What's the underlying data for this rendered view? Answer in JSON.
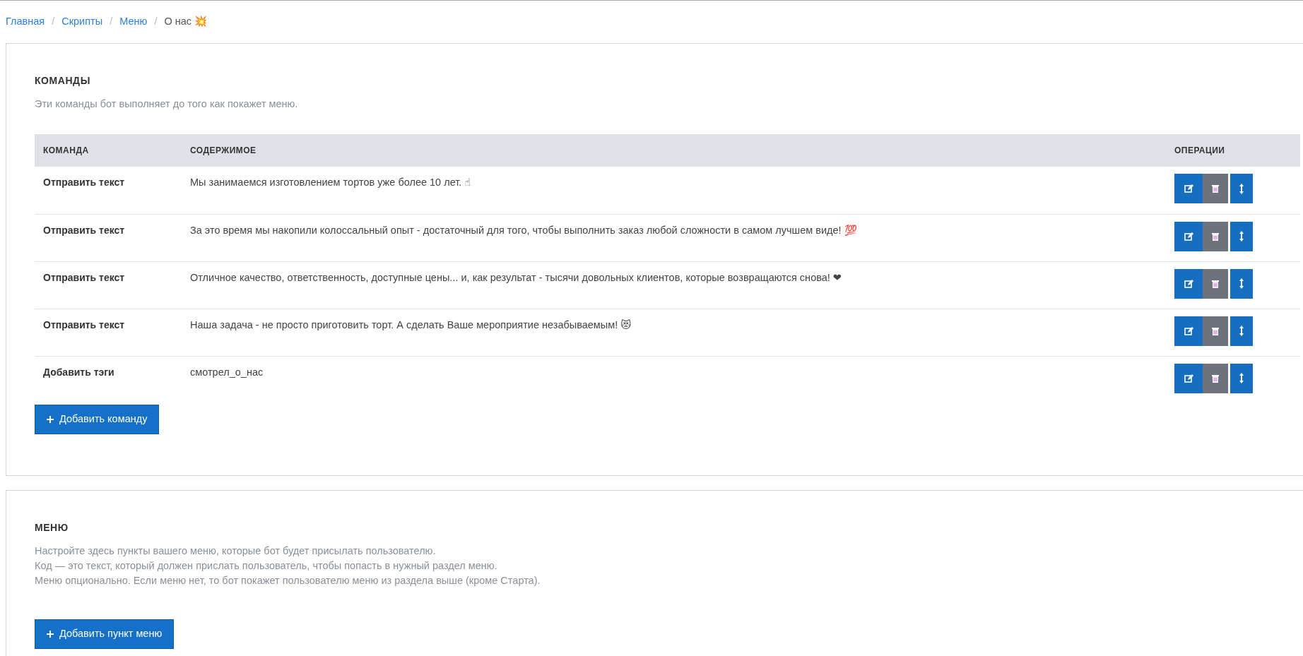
{
  "breadcrumb_separator": "/",
  "breadcrumb": [
    {
      "label": "Главная",
      "selected": false
    },
    {
      "label": "Скрипты",
      "selected": false
    },
    {
      "label": "Меню",
      "selected": false
    },
    {
      "label": "О нас 💥",
      "selected": true
    }
  ],
  "commands": {
    "title": "КОМАНДЫ",
    "description": [
      "Эти команды бот выполняет до того как покажет меню."
    ],
    "table": {
      "columns": [
        "КОМАНДА",
        "СОДЕРЖИМОЕ",
        "ОПЕРАЦИИ"
      ],
      "rows": [
        {
          "command": "Отправить текст",
          "content": "Мы занимаемся изготовлением тортов уже более 10 лет. ☝"
        },
        {
          "command": "Отправить текст",
          "content": "За это время мы накопили колоссальный опыт - достаточный для того, чтобы выполнить заказ любой сложности в самом лучшем виде! 💯"
        },
        {
          "command": "Отправить текст",
          "content": "Отличное качество, ответственность, доступные цены... и, как результат - тысячи довольных клиентов, которые возвращаются снова! ❤"
        },
        {
          "command": "Отправить текст",
          "content": "Наша задача - не просто приготовить торт. А сделать Ваше мероприятие незабываемым! 😻"
        },
        {
          "command": "Добавить тэги",
          "content": "смотрел_о_нас"
        }
      ]
    },
    "add_button": "Добавить команду"
  },
  "menu": {
    "title": "МЕНЮ",
    "description": [
      "Настройте здесь пункты вашего меню, которые бот будет присылать пользователю.",
      "Код — это текст, который должен прислать пользователь, чтобы попасть в нужный раздел меню.",
      "Меню опционально. Если меню нет, то бот покажет пользователю меню из раздела выше (кроме Старта)."
    ],
    "add_button": "Добавить пункт меню"
  }
}
